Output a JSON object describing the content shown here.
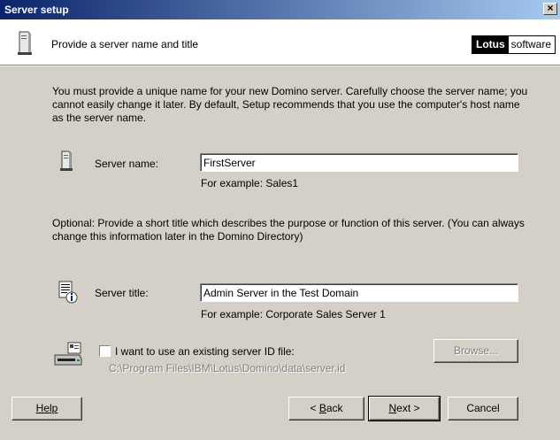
{
  "window": {
    "title": "Server setup",
    "close_glyph": "×"
  },
  "header": {
    "title": "Provide a server name and title",
    "logo_bold": "Lotus",
    "logo_light": "software",
    "icon": "server-tower-icon"
  },
  "intro": "You must provide a unique name for your new Domino server. Carefully choose the server name; you cannot easily change it later. By default, Setup recommends that you use the computer's host name as the server name.",
  "server_name": {
    "label": "Server name:",
    "value": "FirstServer",
    "example": "For example: Sales1",
    "icon": "server-tower-icon"
  },
  "optional": "Optional: Provide a short title which describes the purpose or function of this server. (You can always change this information later in the Domino Directory)",
  "server_title": {
    "label": "Server title:",
    "value": "Admin Server in the Test Domain",
    "example": "For example: Corporate Sales Server 1",
    "icon": "document-info-icon"
  },
  "server_id": {
    "checkbox_label": "I want to use an existing server ID file:",
    "checked": false,
    "path": "C:\\Program Files\\IBM\\Lotus\\Domino\\data\\server.id",
    "browse_label": "Browse...",
    "icon": "id-card-reader-icon"
  },
  "buttons": {
    "help": "Help",
    "back_prefix": "< ",
    "back_key": "B",
    "back_rest": "ack",
    "next_key": "N",
    "next_rest": "ext >",
    "cancel": "Cancel"
  }
}
